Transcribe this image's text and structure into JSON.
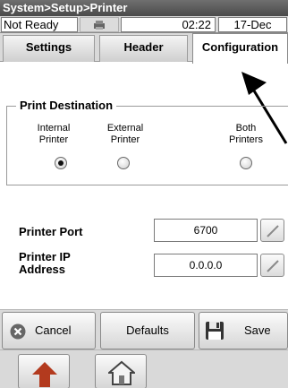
{
  "window": {
    "title": "System>Setup>Printer"
  },
  "status": {
    "state": "Not Ready",
    "time": "02:22",
    "date": "17-Dec",
    "icon": "printer-status-icon"
  },
  "tabs": [
    {
      "label": "Settings",
      "active": false
    },
    {
      "label": "Header",
      "active": false
    },
    {
      "label": "Configuration",
      "active": true
    }
  ],
  "destination": {
    "title": "Print Destination",
    "options": [
      {
        "line1": "Internal",
        "line2": "Printer",
        "selected": true
      },
      {
        "line1": "External",
        "line2": "Printer",
        "selected": false
      },
      {
        "line1": "Both",
        "line2": "Printers",
        "selected": false
      }
    ]
  },
  "fields": {
    "port": {
      "label": "Printer Port",
      "value": "6700"
    },
    "ip": {
      "label_line1": "Printer IP",
      "label_line2": "Address",
      "value": "0.0.0.0"
    }
  },
  "actions": {
    "cancel": "Cancel",
    "defaults": "Defaults",
    "save": "Save"
  },
  "nav": {
    "up_icon": "up-arrow-icon",
    "home_icon": "home-icon"
  },
  "colors": {
    "titlebar": "#5a5a5a",
    "panel": "#d9d9d9",
    "cancel_icon": "#666666"
  }
}
